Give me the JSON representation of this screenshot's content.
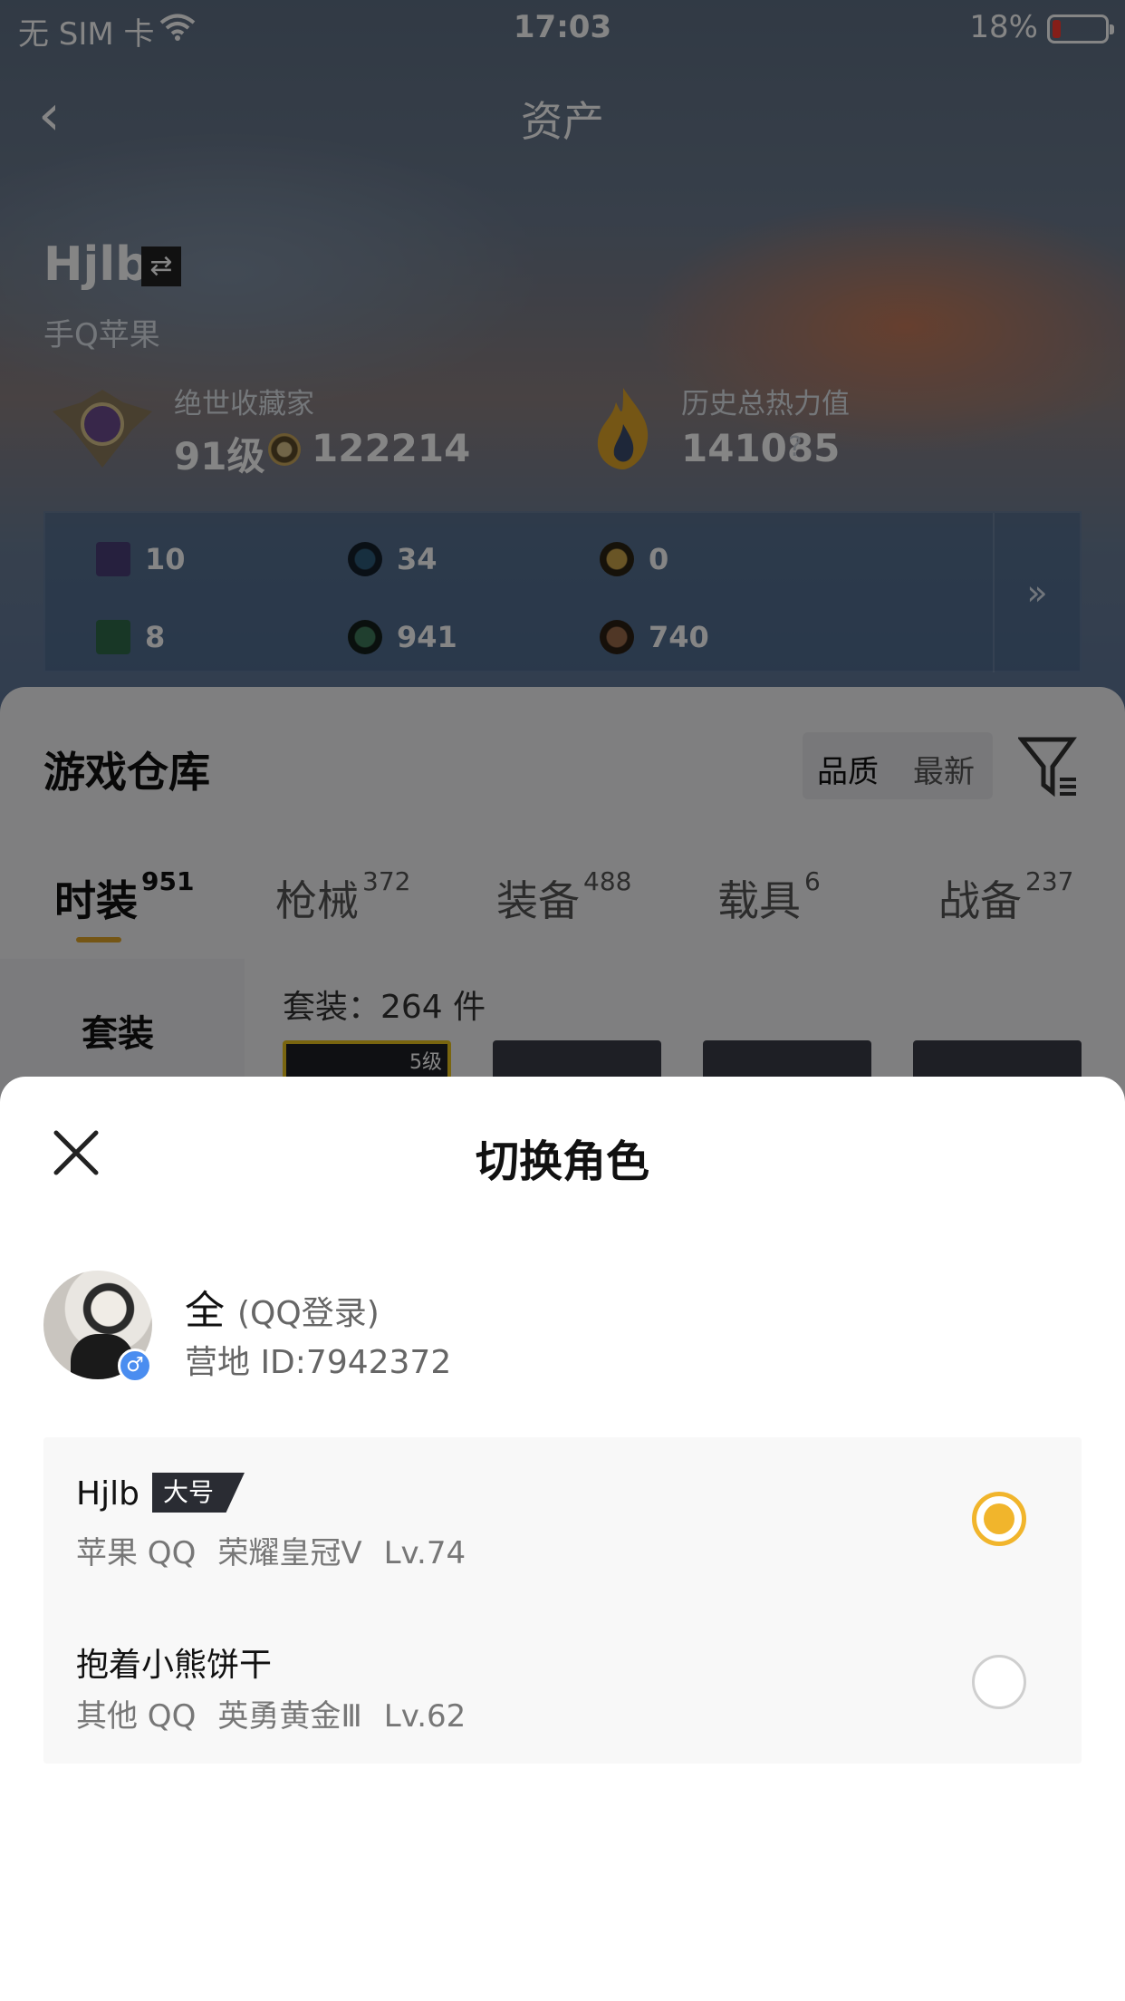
{
  "status_bar": {
    "carrier": "无 SIM 卡",
    "time": "17:03",
    "battery": "18%",
    "battery_level": 0.18
  },
  "background": {
    "nav_title": "资产",
    "player_name": "Hjlb",
    "platform": "手Q苹果",
    "collector": {
      "label": "绝世收藏家",
      "level": "91级",
      "coins": "122214"
    },
    "heat": {
      "label": "历史总热力值",
      "value": "141085",
      "help": "?"
    },
    "stats": {
      "row1": [
        "10",
        "34",
        "0"
      ],
      "row2": [
        "8",
        "941",
        "740"
      ],
      "more": "»"
    },
    "warehouse": {
      "title": "游戏仓库",
      "sort_quality": "品质",
      "sort_newest": "最新",
      "tabs": [
        {
          "label": "时装",
          "count": "951"
        },
        {
          "label": "枪械",
          "count": "372"
        },
        {
          "label": "装备",
          "count": "488"
        },
        {
          "label": "载具",
          "count": "6"
        },
        {
          "label": "战备",
          "count": "237"
        }
      ],
      "side_label": "套装",
      "count_text": "套装：264 件",
      "card_tag": "5级"
    }
  },
  "sheet": {
    "title": "切换角色",
    "user": {
      "name": "全",
      "login": "(QQ登录)",
      "camp_id": "营地 ID:7942372",
      "gender": "♂"
    },
    "roles": [
      {
        "name": "Hjlb",
        "tag": "大号",
        "platform": "苹果 QQ",
        "rank": "荣耀皇冠Ⅴ",
        "level": "Lv.74",
        "selected": true
      },
      {
        "name": "抱着小熊饼干",
        "tag": "",
        "platform": "其他 QQ",
        "rank": "英勇黄金Ⅲ",
        "level": "Lv.62",
        "selected": false
      }
    ],
    "accent_color": "#f1b52c"
  }
}
